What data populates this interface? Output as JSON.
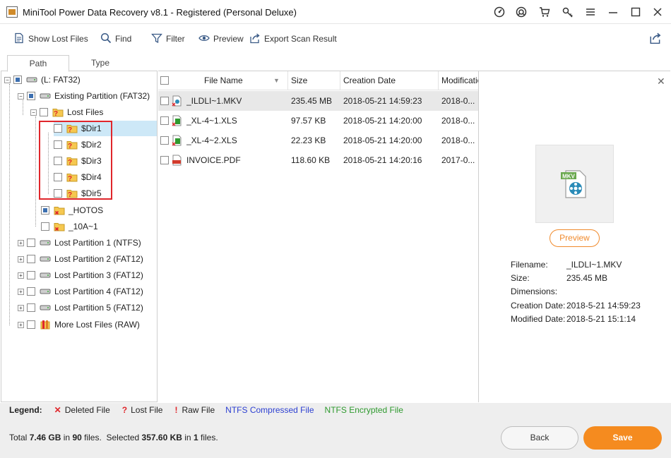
{
  "window": {
    "title": "MiniTool Power Data Recovery v8.1 - Registered (Personal Deluxe)"
  },
  "toolbar": {
    "show_lost_files": "Show Lost Files",
    "find": "Find",
    "filter": "Filter",
    "preview": "Preview",
    "export_scan_result": "Export Scan Result"
  },
  "tabs": {
    "path": "Path",
    "type": "Type"
  },
  "tree": {
    "drive": "(L: FAT32)",
    "existing_partition": "Existing Partition (FAT32)",
    "lost_files": "Lost Files",
    "dirs": [
      "$Dir1",
      "$Dir2",
      "$Dir3",
      "$Dir4",
      "$Dir5"
    ],
    "hotos": "_HOTOS",
    "tenA": "_10A~1",
    "lost_partitions": [
      "Lost Partition 1 (NTFS)",
      "Lost Partition 2 (FAT12)",
      "Lost Partition 3 (FAT12)",
      "Lost Partition 4 (FAT12)",
      "Lost Partition 5 (FAT12)"
    ],
    "more_lost_files": "More Lost Files (RAW)"
  },
  "file_list": {
    "columns": {
      "file_name": "File Name",
      "size": "Size",
      "creation_date": "Creation Date",
      "modification": "Modificatio"
    },
    "rows": [
      {
        "name": "_ILDLI~1.MKV",
        "size": "235.45 MB",
        "created": "2018-05-21 14:59:23",
        "modified": "2018-0...",
        "icon": "mkv-file-icon"
      },
      {
        "name": "_XL-4~1.XLS",
        "size": "97.57 KB",
        "created": "2018-05-21 14:20:00",
        "modified": "2018-0...",
        "icon": "xls-file-icon"
      },
      {
        "name": "_XL-4~2.XLS",
        "size": "22.23 KB",
        "created": "2018-05-21 14:20:00",
        "modified": "2018-0...",
        "icon": "xls-file-icon"
      },
      {
        "name": "INVOICE.PDF",
        "size": "118.60 KB",
        "created": "2018-05-21 14:20:16",
        "modified": "2017-0...",
        "icon": "pdf-file-icon"
      }
    ]
  },
  "preview": {
    "button": "Preview",
    "thumb_badge": "MKV",
    "info": {
      "filename_label": "Filename:",
      "filename": "_ILDLI~1.MKV",
      "size_label": "Size:",
      "size": "235.45 MB",
      "dimensions_label": "Dimensions:",
      "dimensions": "",
      "creation_label": "Creation Date:",
      "creation": "2018-5-21 14:59:23",
      "modified_label": "Modified Date:",
      "modified": "2018-5-21 15:1:14"
    }
  },
  "legend": {
    "label": "Legend:",
    "deleted": "Deleted File",
    "lost": "Lost File",
    "raw": "Raw File",
    "ntfs_compressed": "NTFS Compressed File",
    "ntfs_encrypted": "NTFS Encrypted File",
    "colors": {
      "deleted_mark": "#e0262b",
      "ntfs_compressed": "#2c3fd1",
      "ntfs_encrypted": "#2f9a2f"
    }
  },
  "status": {
    "total_prefix": "Total",
    "total_size": "7.46 GB",
    "in": "in",
    "total_files": "90",
    "files": "files.",
    "selected_prefix": "Selected",
    "selected_size": "357.60 KB",
    "selected_files": "1",
    "files_end": "files."
  },
  "buttons": {
    "back": "Back",
    "save": "Save"
  }
}
